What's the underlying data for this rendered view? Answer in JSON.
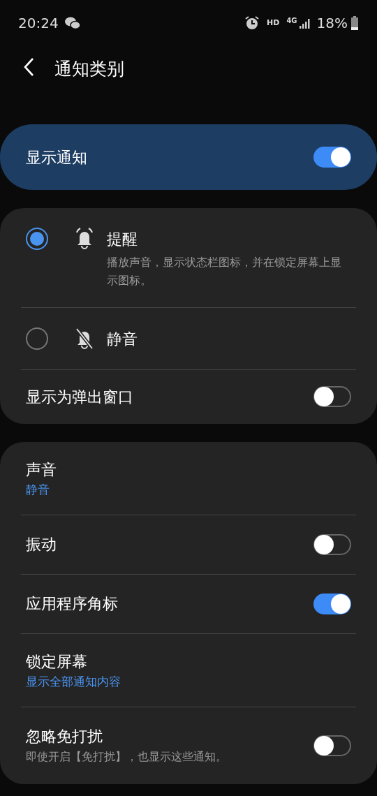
{
  "status_bar": {
    "time": "20:24",
    "hd": "HD",
    "network": "4G",
    "battery": "18%"
  },
  "header": {
    "title": "通知类别"
  },
  "master": {
    "label": "显示通知",
    "on": true
  },
  "alert_modes": [
    {
      "kind": "alert",
      "label": "提醒",
      "description": "播放声音，显示状态栏图标，并在锁定屏幕上显示图标。",
      "selected": true
    },
    {
      "kind": "silent",
      "label": "静音",
      "selected": false
    }
  ],
  "popup": {
    "label": "显示为弹出窗口",
    "on": false
  },
  "settings": [
    {
      "kind": "value",
      "label": "声音",
      "value": "静音"
    },
    {
      "kind": "switch",
      "label": "振动",
      "on": false
    },
    {
      "kind": "switch",
      "label": "应用程序角标",
      "on": true
    },
    {
      "kind": "value",
      "label": "锁定屏幕",
      "value": "显示全部通知内容"
    },
    {
      "kind": "switch",
      "label": "忽略免打扰",
      "description": "即使开启【免打扰】，也显示这些通知。",
      "on": false
    }
  ]
}
